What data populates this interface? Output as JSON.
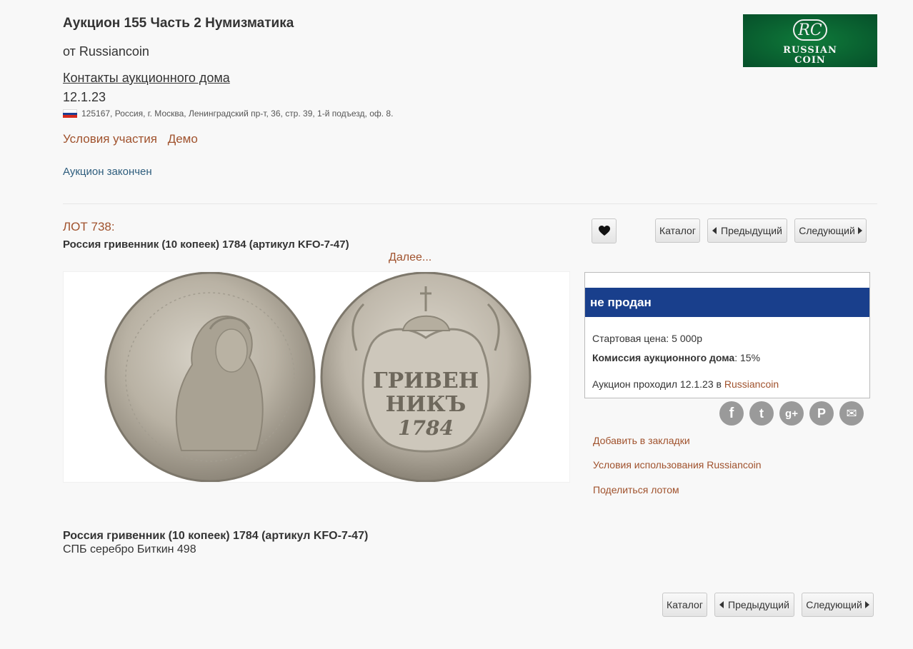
{
  "header": {
    "title": "Аукцион 155 Часть 2 Нумизматика",
    "from": "от Russiancoin",
    "contacts_link": "Контакты аукционного дома",
    "date": "12.1.23",
    "address": "125167, Россия, г. Москва, Ленинградский пр-т, 36, стр. 39, 1-й подъезд, оф. 8.",
    "flag_colors": [
      "#ffffff",
      "#1c3f94",
      "#d52b1e"
    ],
    "terms_link": "Условия участия",
    "demo_link": "Демо",
    "auction_status": "Аукцион закончен"
  },
  "logo": {
    "monogram": "RC",
    "line1": "RUSSIAN",
    "line2": "COIN",
    "bg_color": "#0b6a34"
  },
  "lot": {
    "number_label": "ЛОТ 738:",
    "title": "Россия гривенник (10 копеек) 1784 (артикул KFO-7-47)",
    "more_link": "Далее...",
    "coin_image_icon": "coin-photo",
    "reverse_legend_line1": "ГРИВЕН",
    "reverse_legend_line2": "НИКЪ",
    "reverse_year": "1784"
  },
  "nav": {
    "favorite_icon": "heart-icon",
    "catalog": "Каталог",
    "prev": "Предыдущий",
    "next": "Следующий"
  },
  "status_panel": {
    "status": "не продан",
    "status_color": "#193f8c",
    "start_price_label": "Стартовая цена:",
    "start_price_value": "5 000р",
    "commission_label": "Комиссия аукционного дома",
    "commission_value": ": 15%",
    "held_text": "Аукцион проходил 12.1.23 в",
    "held_link": "Russiancoin"
  },
  "social": {
    "icons": [
      "facebook-icon",
      "twitter-icon",
      "google-plus-icon",
      "pinterest-icon",
      "email-icon"
    ],
    "glyphs": [
      "f",
      "t",
      "g+",
      "P",
      "✉"
    ]
  },
  "side_links": {
    "bookmark": "Добавить в закладки",
    "terms_of_use": "Условия использования Russiancoin",
    "share": "Поделиться лотом"
  },
  "description": {
    "title": "Россия гривенник (10 копеек) 1784 (артикул KFO-7-47)",
    "text": "СПБ серебро Биткин 498"
  }
}
